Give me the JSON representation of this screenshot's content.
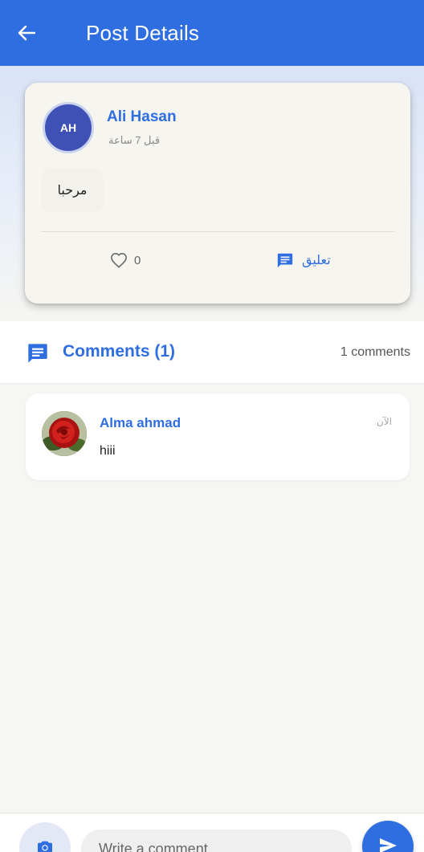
{
  "app_bar": {
    "title": "Post Details",
    "back_icon": "arrow-left-icon",
    "color": "#2e6ee0"
  },
  "post": {
    "author_initials": "AH",
    "author_name": "Ali Hasan",
    "time": "قبل 7 ساعة",
    "text": "مرحبا",
    "like_icon": "heart-outline-icon",
    "likes": "0",
    "comment_icon": "comment-icon",
    "comment_label": "تعليق"
  },
  "comments_section": {
    "icon": "comment-icon",
    "title": "Comments (1)",
    "count_label": "1 comments",
    "items": [
      {
        "author": "Alma ahmad",
        "time": "الآن",
        "text": "hiii",
        "avatar": "rose-photo"
      }
    ]
  },
  "composer": {
    "camera_icon": "camera-icon",
    "placeholder": "Write a comment...",
    "send_icon": "send-icon"
  }
}
